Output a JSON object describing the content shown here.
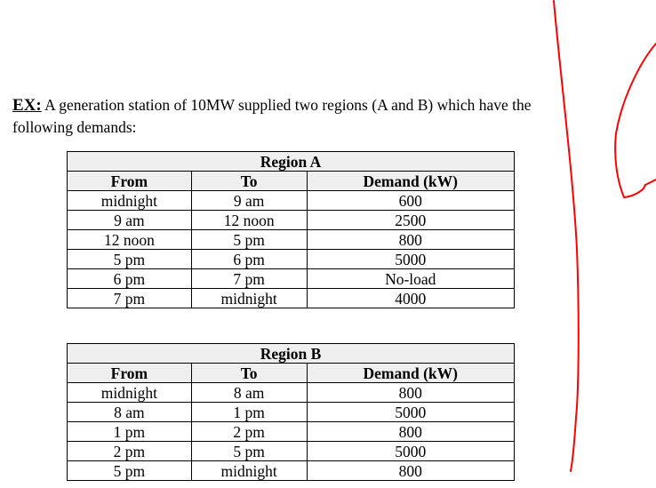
{
  "intro": {
    "label": "EX:",
    "text": " A generation station of 10MW supplied two regions (A and B) which have the following demands:"
  },
  "tables": [
    {
      "title": "Region A",
      "headers": [
        "From",
        "To",
        "Demand (kW)"
      ],
      "rows": [
        [
          "midnight",
          "9 am",
          "600"
        ],
        [
          "9 am",
          "12 noon",
          "2500"
        ],
        [
          "12 noon",
          "5 pm",
          "800"
        ],
        [
          "5 pm",
          "6 pm",
          "5000"
        ],
        [
          "6 pm",
          "7 pm",
          "No-load"
        ],
        [
          "7 pm",
          "midnight",
          "4000"
        ]
      ]
    },
    {
      "title": "Region B",
      "headers": [
        "From",
        "To",
        "Demand (kW)"
      ],
      "rows": [
        [
          "midnight",
          "8 am",
          "800"
        ],
        [
          "8 am",
          "1 pm",
          "5000"
        ],
        [
          "1 pm",
          "2 pm",
          "800"
        ],
        [
          "2 pm",
          "5 pm",
          "5000"
        ],
        [
          "5 pm",
          "midnight",
          "800"
        ]
      ]
    }
  ],
  "annotations": {
    "ink_color": "#ff0000"
  }
}
